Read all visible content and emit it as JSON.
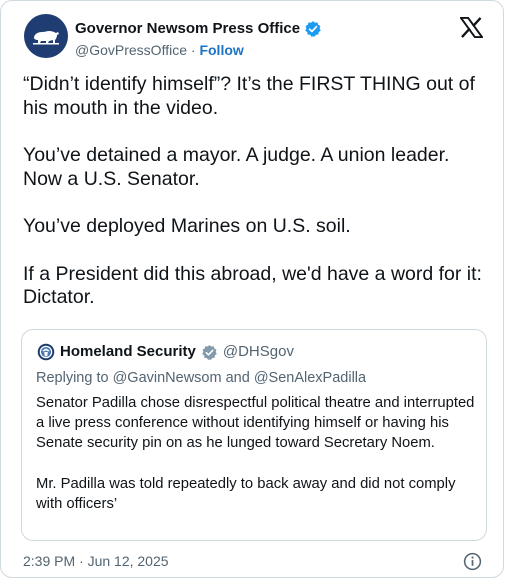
{
  "author": {
    "name": "Governor Newsom Press Office",
    "handle": "@GovPressOffice",
    "separator": "·",
    "follow_label": "Follow"
  },
  "tweet": {
    "paragraphs": [
      "“Didn’t identify himself”? It’s the FIRST THING out of his mouth in the video.",
      "You’ve detained a mayor. A judge. A union leader. Now a U.S. Senator.",
      "You’ve deployed Marines on U.S. soil.",
      "If a President did this abroad, we'd have a word for it: Dictator."
    ]
  },
  "quoted": {
    "name": "Homeland Security",
    "handle": "@DHSgov",
    "replying_to": "Replying to @GavinNewsom and @SenAlexPadilla",
    "paragraphs": [
      "Senator Padilla chose disrespectful political theatre and interrupted a live press conference without identifying himself or having his Senate security pin on as he lunged toward Secretary Noem.",
      "Mr. Padilla was told repeatedly to back away and did not comply with officers’"
    ]
  },
  "footer": {
    "timestamp": "2:39 PM · Jun 12, 2025"
  },
  "icons": {
    "verified": "verified-badge-icon",
    "x_logo": "x-logo-icon",
    "info": "info-icon",
    "government_badge": "gray-verified-icon"
  },
  "colors": {
    "accent": "#1d9bf0",
    "link": "#1d74c3",
    "secondary_text": "#536471",
    "border": "#cfd9de",
    "gov_badge": "#829aab"
  }
}
